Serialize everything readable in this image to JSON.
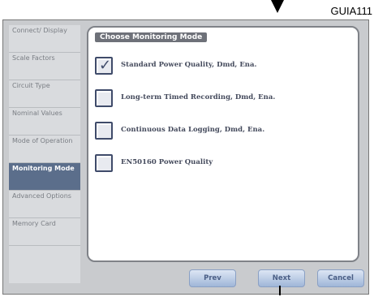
{
  "figure_label": "GUIA111",
  "sidebar": {
    "items": [
      {
        "label": "Connect/ Display"
      },
      {
        "label": "Scale Factors"
      },
      {
        "label": "Circuit Type"
      },
      {
        "label": "Nominal Values"
      },
      {
        "label": "Mode of Operation"
      },
      {
        "label": "Monitoring Mode"
      },
      {
        "label": "Advanced Options"
      },
      {
        "label": "Memory Card"
      }
    ],
    "active_index": 5
  },
  "panel": {
    "title": "Choose Monitoring Mode",
    "options": [
      {
        "label": "Standard Power Quality, Dmd, Ena.",
        "checked": true
      },
      {
        "label": "Long-term Timed Recording, Dmd, Ena.",
        "checked": false
      },
      {
        "label": "Continuous Data Logging, Dmd, Ena.",
        "checked": false
      },
      {
        "label": "EN50160 Power Quality",
        "checked": false
      }
    ]
  },
  "buttons": {
    "prev": "Prev",
    "next": "Next",
    "cancel": "Cancel"
  }
}
